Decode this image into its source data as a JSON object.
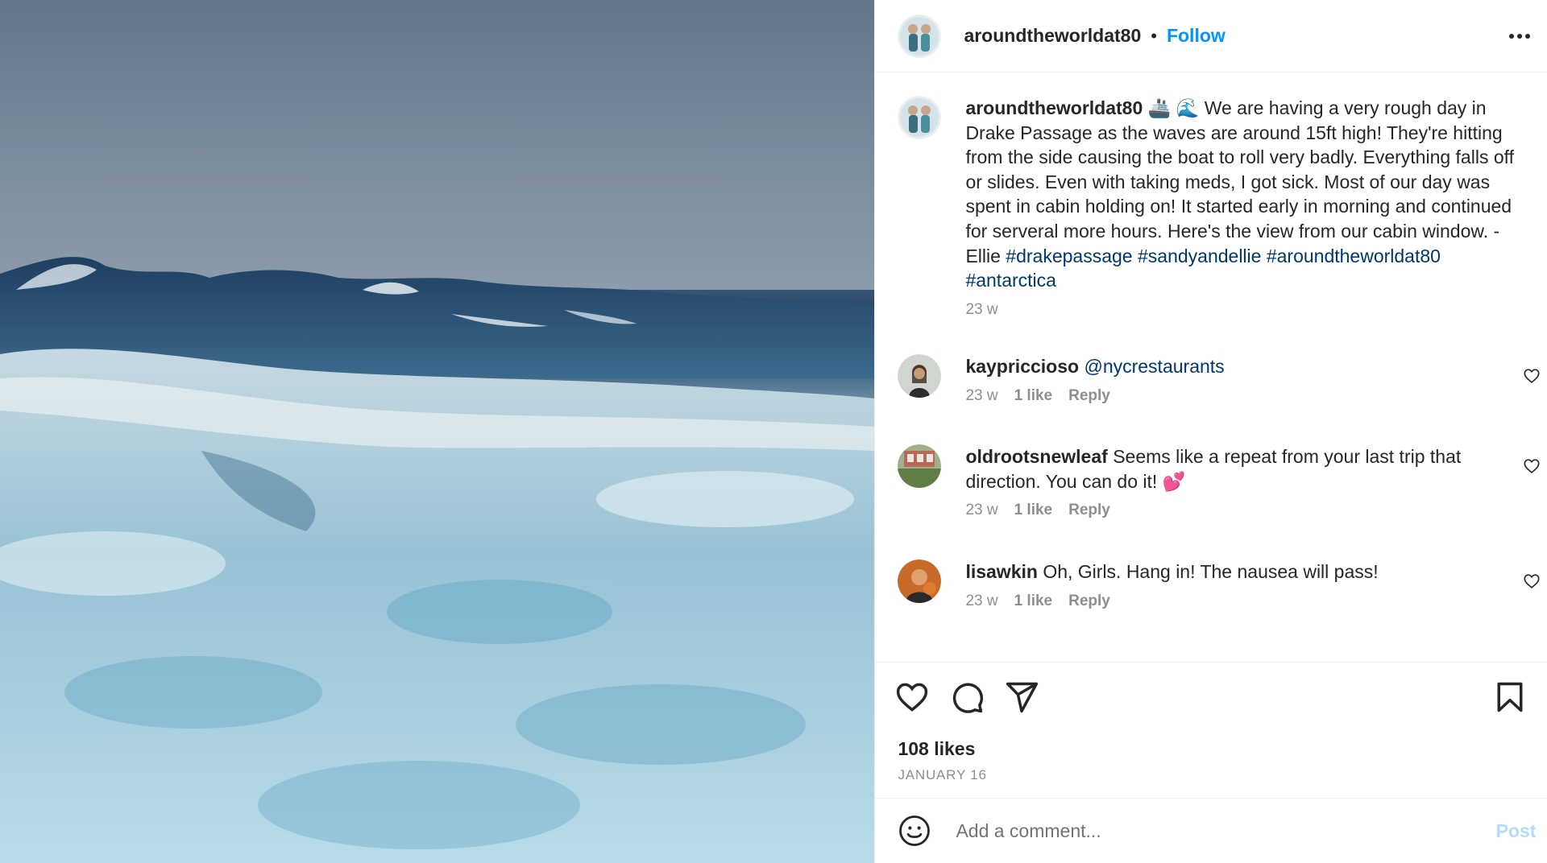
{
  "header": {
    "username": "aroundtheworldat80",
    "separator": "•",
    "follow_label": "Follow",
    "more_icon": "more-horizontal-icon"
  },
  "caption": {
    "username": "aroundtheworldat80",
    "emojis": "🚢 🌊",
    "text": "We are having a very rough day in Drake Passage as the waves are around 15ft high! They're hitting from the side causing the boat to roll very badly. Everything falls off or slides. Even with taking meds, I got sick. Most of our day was spent in cabin holding on! It started early in morning and continued for serveral more hours. Here's the view from our cabin window. - Ellie",
    "hashtags": [
      "#drakepassage",
      "#sandyandellie",
      "#aroundtheworldat80",
      "#antarctica"
    ],
    "time": "23 w"
  },
  "comments": [
    {
      "username": "kaypriccioso",
      "text": "@nycrestaurants",
      "time": "23 w",
      "likes": "1 like",
      "reply": "Reply"
    },
    {
      "username": "oldrootsnewleaf",
      "text": "Seems like a repeat from your last trip that direction. You can do it! 💕",
      "time": "23 w",
      "likes": "1 like",
      "reply": "Reply"
    },
    {
      "username": "lisawkin",
      "text": "Oh, Girls. Hang in! The nausea will pass!",
      "time": "23 w",
      "likes": "1 like",
      "reply": "Reply"
    }
  ],
  "actions": {
    "like_icon": "heart-icon",
    "comment_icon": "comment-icon",
    "share_icon": "share-icon",
    "save_icon": "bookmark-icon",
    "likes_count": "108 likes",
    "date": "JANUARY 16"
  },
  "add_comment": {
    "emoji_icon": "emoji-icon",
    "placeholder": "Add a comment...",
    "post_label": "Post"
  },
  "colors": {
    "link_blue": "#0095f6",
    "hashtag": "#00376b",
    "muted": "#8e8e8e",
    "post_disabled": "#b3dbff"
  }
}
